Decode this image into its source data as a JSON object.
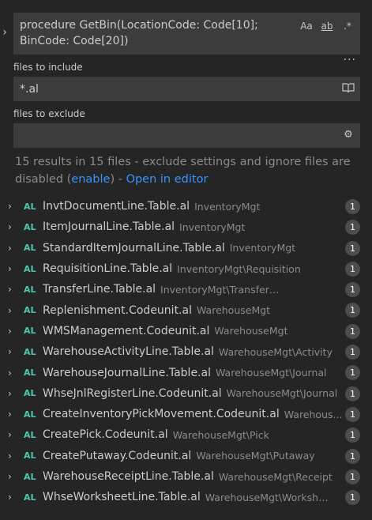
{
  "search": {
    "query": "procedure GetBin(LocationCode: Code[10];\nBinCode: Code[20])",
    "options": {
      "match_case": "Aa",
      "whole_word": "ab",
      "regex": ".*"
    },
    "more": "···"
  },
  "include": {
    "label": "files to include",
    "value": "*.al"
  },
  "exclude": {
    "label": "files to exclude",
    "value": ""
  },
  "message": {
    "text": "15 results in 15 files - exclude settings and ignore files are disabled (",
    "enable_link": "enable",
    "text_after": ") - ",
    "open_editor_link": "Open in editor"
  },
  "results": [
    {
      "file": "InvtDocumentLine.Table.al",
      "path": "InventoryMgt",
      "count": "1"
    },
    {
      "file": "ItemJournalLine.Table.al",
      "path": "InventoryMgt",
      "count": "1"
    },
    {
      "file": "StandardItemJournalLine.Table.al",
      "path": "InventoryMgt",
      "count": "1"
    },
    {
      "file": "RequisitionLine.Table.al",
      "path": "InventoryMgt\\Requisition",
      "count": "1"
    },
    {
      "file": "TransferLine.Table.al",
      "path": "InventoryMgt\\TransferOrder",
      "count": "1"
    },
    {
      "file": "Replenishment.Codeunit.al",
      "path": "WarehouseMgt",
      "count": "1"
    },
    {
      "file": "WMSManagement.Codeunit.al",
      "path": "WarehouseMgt",
      "count": "1"
    },
    {
      "file": "WarehouseActivityLine.Table.al",
      "path": "WarehouseMgt\\Activity",
      "count": "1"
    },
    {
      "file": "WarehouseJournalLine.Table.al",
      "path": "WarehouseMgt\\Journal",
      "count": "1"
    },
    {
      "file": "WhseJnlRegisterLine.Codeunit.al",
      "path": "WarehouseMgt\\Journal",
      "count": "1"
    },
    {
      "file": "CreateInventoryPickMovement.Codeunit.al",
      "path": "Warehous...",
      "count": "1"
    },
    {
      "file": "CreatePick.Codeunit.al",
      "path": "WarehouseMgt\\Pick",
      "count": "1"
    },
    {
      "file": "CreatePutaway.Codeunit.al",
      "path": "WarehouseMgt\\Putaway",
      "count": "1"
    },
    {
      "file": "WarehouseReceiptLine.Table.al",
      "path": "WarehouseMgt\\Receipt",
      "count": "1"
    },
    {
      "file": "WhseWorksheetLine.Table.al",
      "path": "WarehouseMgt\\Worksheet",
      "count": "1"
    }
  ],
  "file_icon": "AL",
  "colors": {
    "background": "#252526",
    "input": "#3c3c3c",
    "link": "#3794ff",
    "al_icon": "#4ec9b0"
  }
}
